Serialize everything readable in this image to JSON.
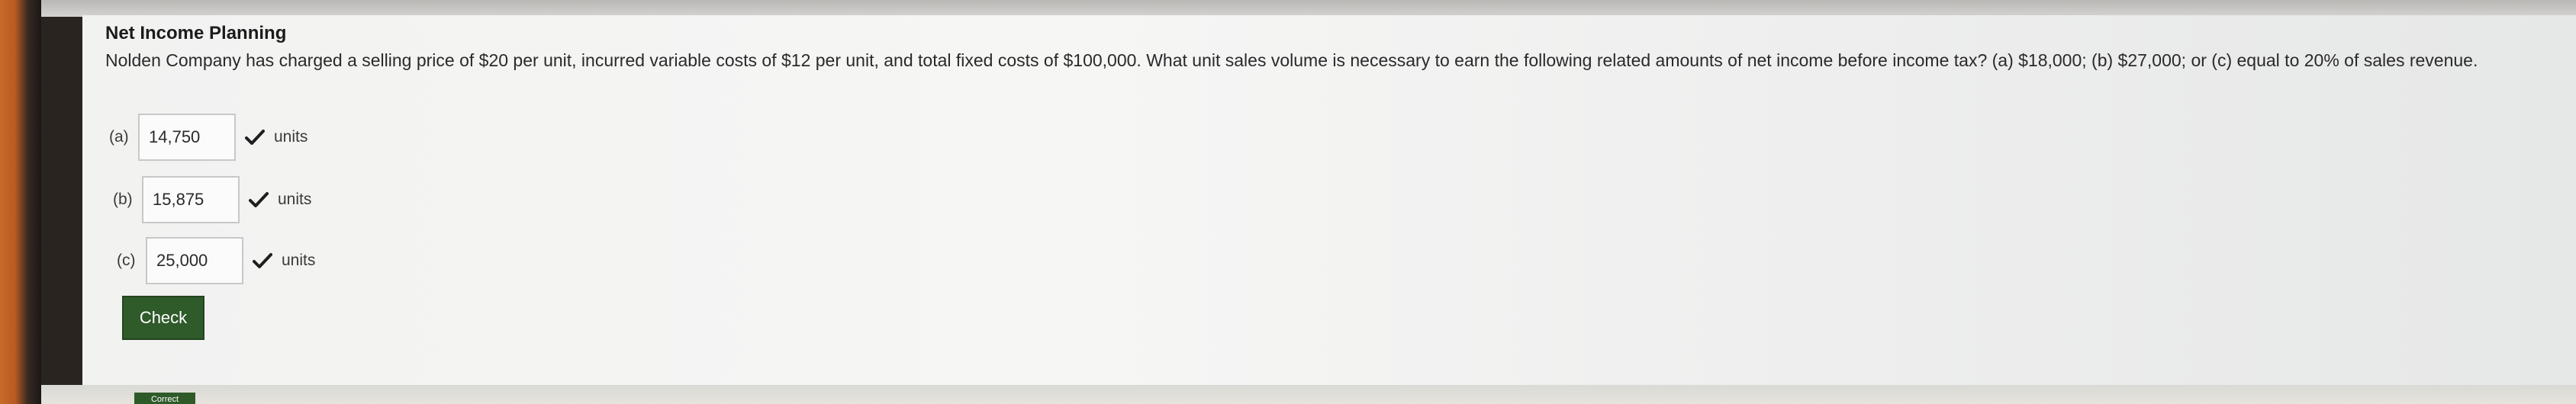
{
  "problem": {
    "title": "Net Income Planning",
    "question": "Nolden Company has charged a selling price of $20 per unit, incurred variable costs of $12 per unit, and total fixed costs of $100,000. What unit sales volume is necessary to earn the following related amounts of net income before income tax? (a) $18,000; (b) $27,000; or (c) equal to 20% of sales revenue."
  },
  "answers": [
    {
      "label": "(a)",
      "value": "14,750",
      "units": "units",
      "status": "correct"
    },
    {
      "label": "(b)",
      "value": "15,875",
      "units": "units",
      "status": "correct"
    },
    {
      "label": "(c)",
      "value": "25,000",
      "units": "units",
      "status": "correct"
    }
  ],
  "actions": {
    "check_label": "Check",
    "bottom_tab_label": "Correct"
  },
  "colors": {
    "button_bg": "#2f5a2a",
    "check_mark": "#1e1e1e"
  }
}
